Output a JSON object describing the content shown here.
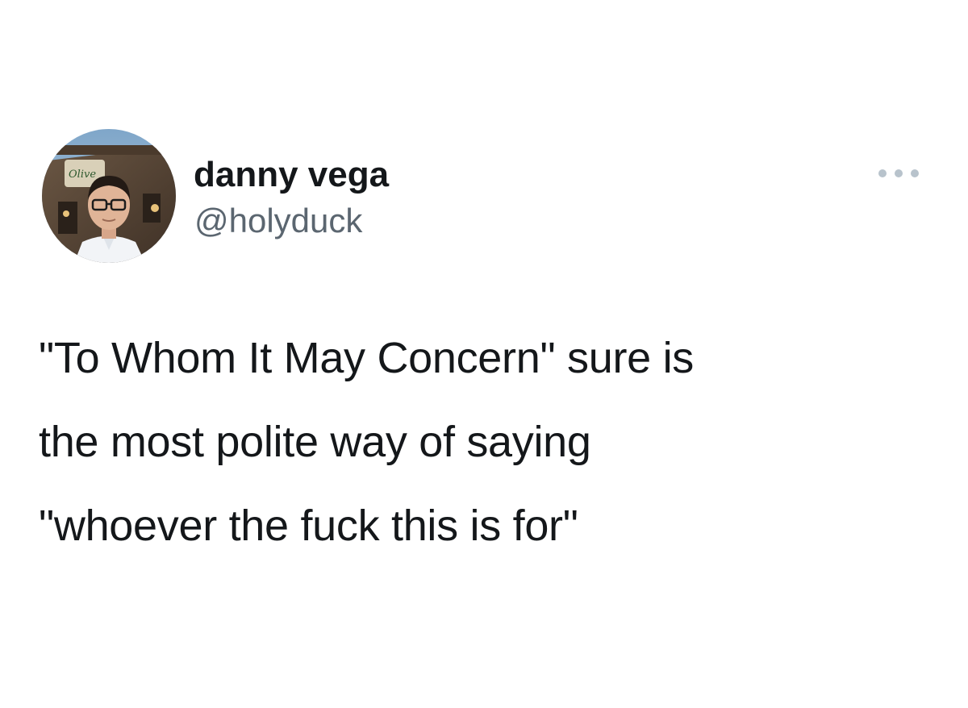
{
  "tweet": {
    "author": {
      "display_name": "danny vega",
      "handle": "@holyduck",
      "avatar_sign_text": "Olive"
    },
    "text_lines": [
      "\"To Whom It May Concern\" sure is",
      "the most polite way of saying",
      "\"whoever the fuck this is for\""
    ],
    "more_icon": "more-horizontal-icon",
    "colors": {
      "name": "#14171a",
      "handle": "#5b6670",
      "text": "#14171a",
      "more_dots": "#b8c3cc"
    }
  }
}
